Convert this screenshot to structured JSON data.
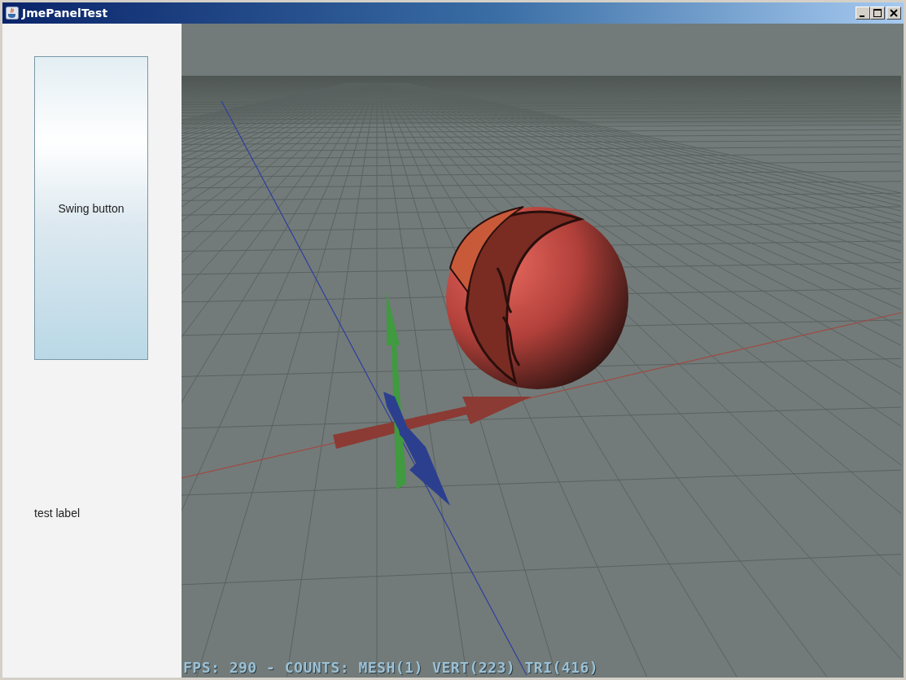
{
  "window": {
    "title": "JmePanelTest"
  },
  "left_panel": {
    "button": {
      "label": "Swing button"
    },
    "label": "test label"
  },
  "viewport": {
    "stats": "FPS: 290 - COUNTS: MESH(1) VERT(223) TRI(416)"
  }
}
